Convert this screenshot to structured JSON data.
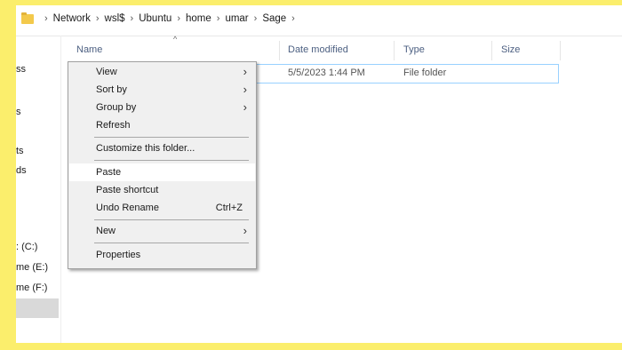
{
  "breadcrumb": {
    "items": [
      "Network",
      "wsl$",
      "Ubuntu",
      "home",
      "umar",
      "Sage"
    ]
  },
  "nav": {
    "items": [
      "ss",
      "s",
      "ts",
      "ds",
      ": (C:)",
      "me (E:)",
      "me (F:)"
    ]
  },
  "columns": {
    "name": "Name",
    "date": "Date modified",
    "type": "Type",
    "size": "Size"
  },
  "file": {
    "date": "5/5/2023 1:44 PM",
    "type": "File folder"
  },
  "context_menu": {
    "view": "View",
    "sort_by": "Sort by",
    "group_by": "Group by",
    "refresh": "Refresh",
    "customize": "Customize this folder...",
    "paste": "Paste",
    "paste_shortcut": "Paste shortcut",
    "undo_rename": "Undo Rename",
    "undo_shortcut": "Ctrl+Z",
    "new": "New",
    "properties": "Properties"
  },
  "colors": {
    "background": "#fbee6c",
    "selection_border": "#99d1ff",
    "menu_bg": "#f0f0f0",
    "folder": "#f3c94b"
  }
}
